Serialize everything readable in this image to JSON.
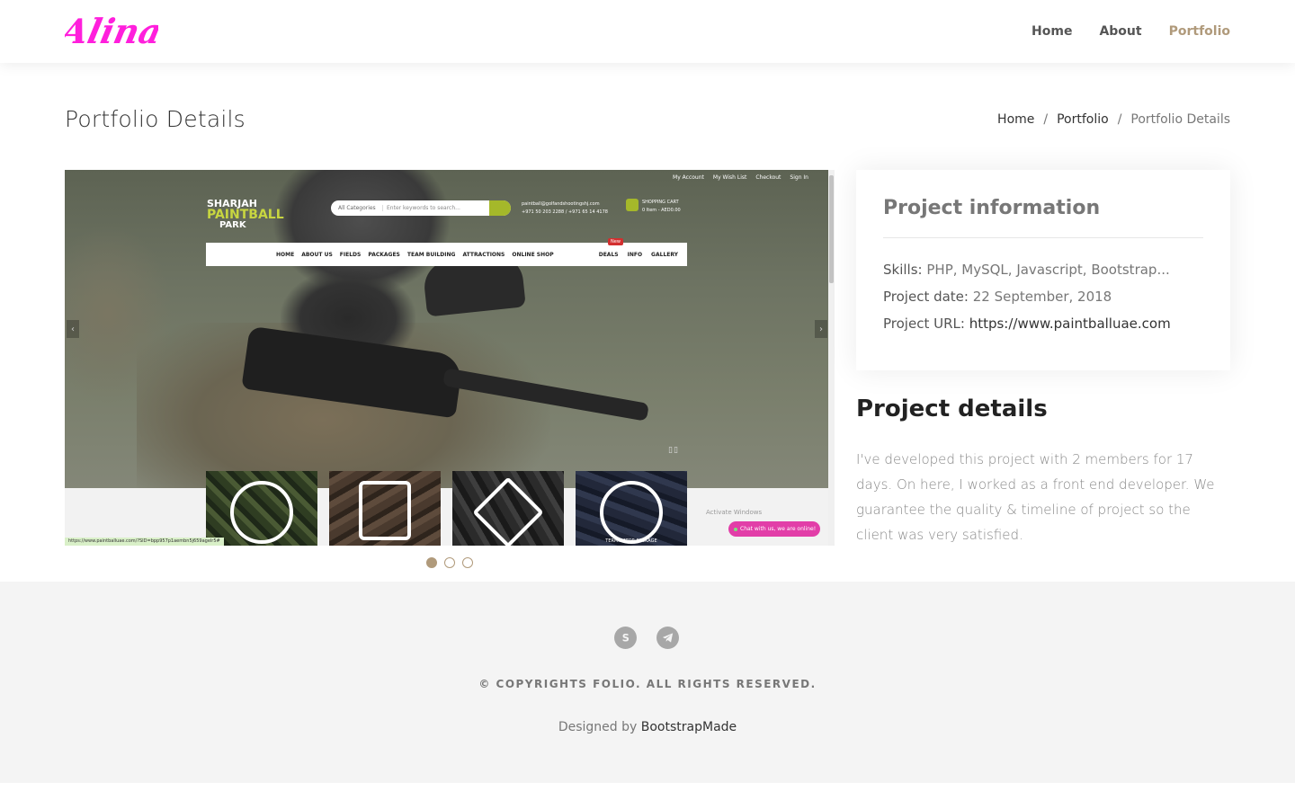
{
  "header": {
    "logo_text": "Alina",
    "nav": [
      {
        "label": "Home",
        "active": false
      },
      {
        "label": "About",
        "active": false
      },
      {
        "label": "Portfolio",
        "active": true
      }
    ]
  },
  "page": {
    "title": "Portfolio Details",
    "breadcrumb": [
      "Home",
      "Portfolio",
      "Portfolio Details"
    ]
  },
  "screenshot": {
    "topbar": [
      "My Account",
      "My Wish List",
      "Checkout",
      "Sign In"
    ],
    "brand": [
      "SHARJAH",
      "PAINTBALL",
      "PARK"
    ],
    "search_category": "All Categories",
    "search_placeholder": "Enter keywords to search...",
    "contact": [
      "paintball@golfandshootingshj.com",
      "+971 50 203 2288 / +971 65 14 4178"
    ],
    "cart": [
      "SHOPPING CART",
      "0 Item - AED0.00"
    ],
    "menu": [
      "HOME",
      "ABOUT US",
      "FIELDS",
      "PACKAGES",
      "TEAM BUILDING",
      "ATTRACTIONS",
      "ONLINE SHOP"
    ],
    "menu_right": [
      "DEALS",
      "INFO",
      "GALLERY"
    ],
    "new_badge": "New",
    "tile_label": "TERMINATOR PACKAGE",
    "activate": "Activate Windows",
    "chat": "Chat with us, we are online!",
    "status_url": "https://www.paintballuae.com/?SID=bpp957p1aembn5j659agelr5#"
  },
  "slider": {
    "dots": 3,
    "active_index": 0
  },
  "project_info": {
    "title": "Project information",
    "skills_label": "Skills:",
    "skills_value": "PHP, MySQL, Javascript, Bootstrap...",
    "date_label": "Project date:",
    "date_value": "22 September, 2018",
    "url_label": "Project URL:",
    "url_value": "https://www.paintballuae.com"
  },
  "project_details": {
    "title": "Project details",
    "text": "I've developed this project with 2 members for 17 days. On here, I worked as a front end developer. We guarantee the quality & timeline of project so the client was very satisfied."
  },
  "footer": {
    "social": [
      "skype-icon",
      "telegram-icon"
    ],
    "copyright": "© COPYRIGHTS FOLIO. ALL RIGHTS RESERVED.",
    "designed_prefix": "Designed by ",
    "designed_credit": "BootstrapMade"
  },
  "colors": {
    "accent": "#b09a7b",
    "logo": "#ff1fdc",
    "footer_bg": "#f4f4f4"
  }
}
